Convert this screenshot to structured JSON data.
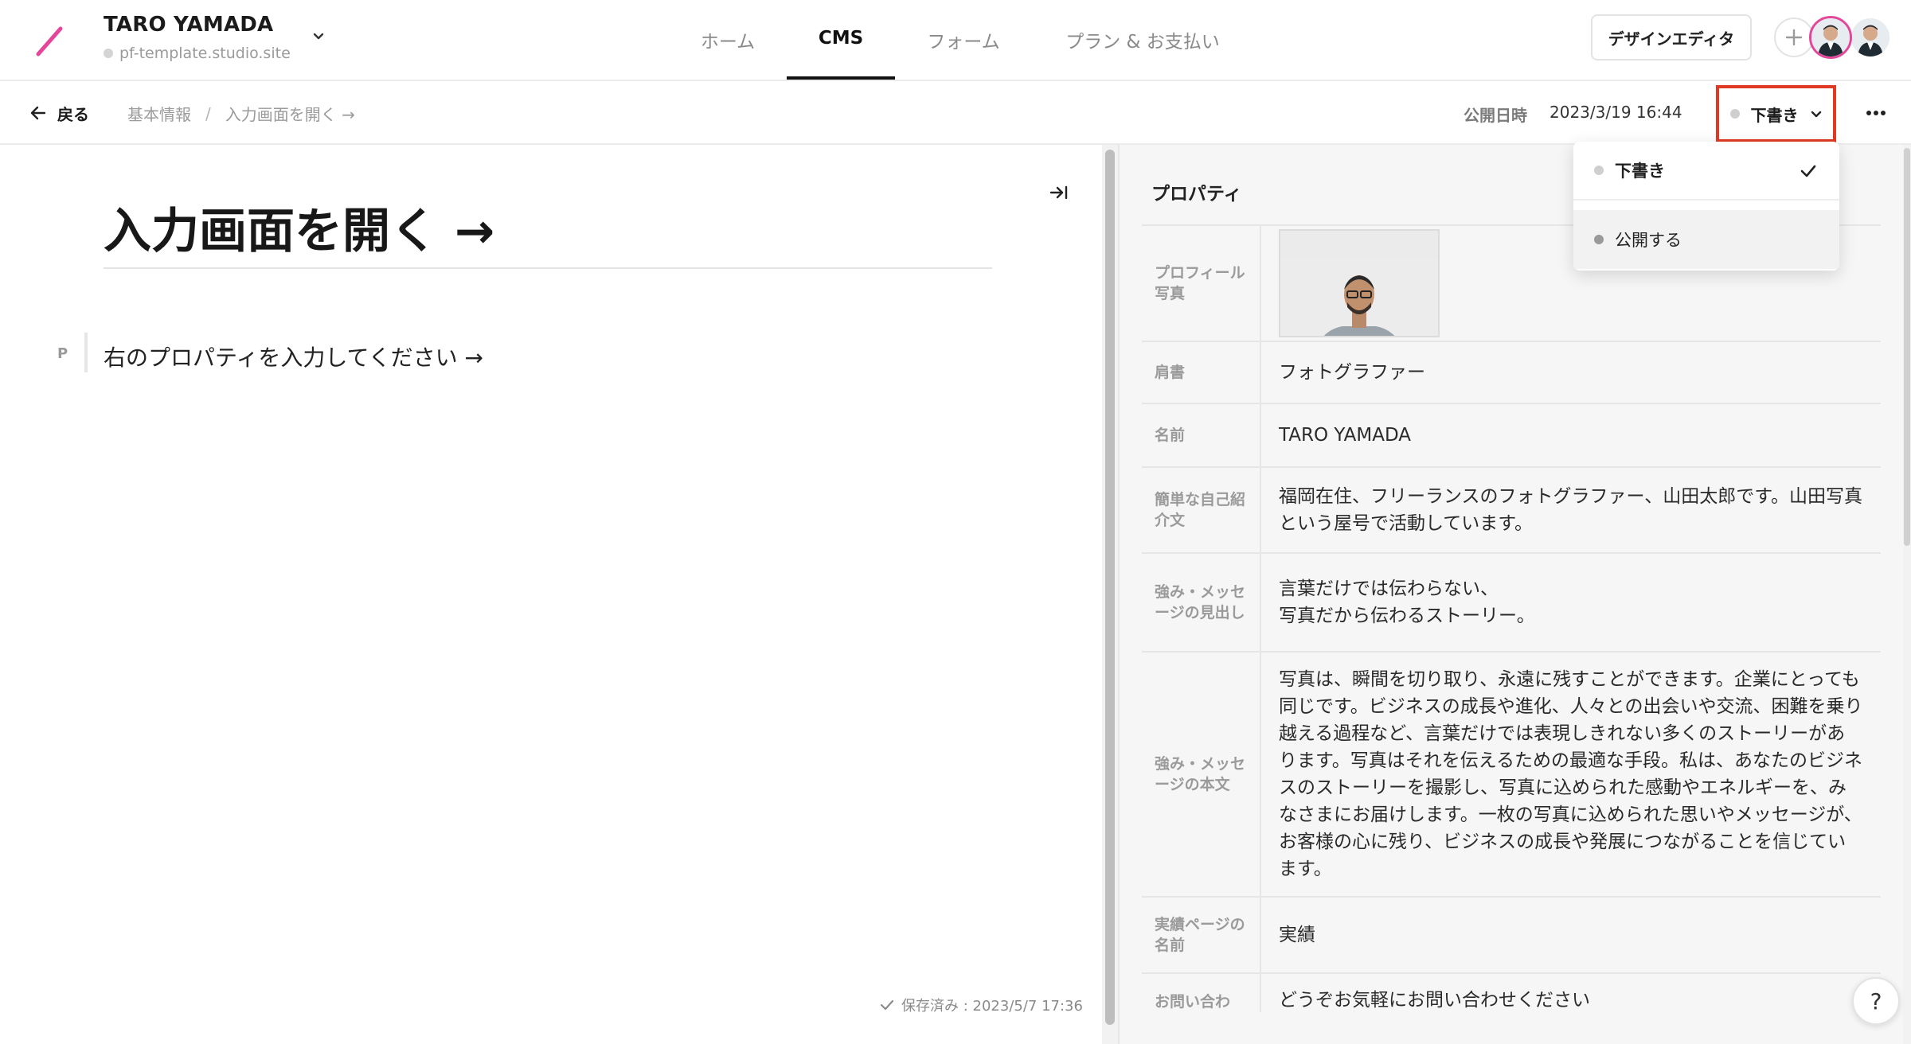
{
  "header": {
    "site_name": "TARO YAMADA",
    "site_url": "pf-template.studio.site",
    "tabs": [
      {
        "label": "ホーム",
        "active": false
      },
      {
        "label": "CMS",
        "active": true
      },
      {
        "label": "フォーム",
        "active": false
      },
      {
        "label": "プラン & お支払い",
        "active": false
      }
    ],
    "design_editor_label": "デザインエディタ",
    "accent_color": "#e4479a"
  },
  "subheader": {
    "back_label": "戻る",
    "breadcrumb": [
      "基本情報",
      "入力画面を開く →"
    ],
    "publish_date_label": "公開日時",
    "publish_date_value": "2023/3/19 16:44",
    "status_label": "下書き",
    "highlight_color": "#e03a24"
  },
  "status_menu": {
    "items": [
      {
        "label": "下書き",
        "selected": true,
        "dot_color": "#cfcfcf"
      },
      {
        "label": "公開する",
        "selected": false,
        "dot_color": "#9a9a9a"
      }
    ]
  },
  "editor": {
    "title": "入力画面を開く →",
    "block_type": "P",
    "paragraph": "右のプロパティを入力してください →",
    "saved_status": "保存済み : 2023/5/7 17:36"
  },
  "properties": {
    "title": "プロパティ",
    "rows": [
      {
        "label": "プロフィール写真",
        "value": ""
      },
      {
        "label": "肩書",
        "value": "フォトグラファー"
      },
      {
        "label": "名前",
        "value": "TARO YAMADA"
      },
      {
        "label": "簡単な自己紹介文",
        "value": "福岡在住、フリーランスのフォトグラファー、山田太郎です。山田写真という屋号で活動しています。"
      },
      {
        "label": "強み・メッセージの見出し",
        "value": "言葉だけでは伝わらない、\n写真だから伝わるストーリー。"
      },
      {
        "label": "強み・メッセージの本文",
        "value": "写真は、瞬間を切り取り、永遠に残すことができます。企業にとっても同じです。ビジネスの成長や進化、人々との出会いや交流、困難を乗り越える過程など、言葉だけでは表現しきれない多くのストーリーがあります。写真はそれを伝えるための最適な手段。私は、あなたのビジネスのストーリーを撮影し、写真に込められた感動やエネルギーを、みなさまにお届けします。一枚の写真に込められた思いやメッセージが、お客様の心に残り、ビジネスの成長や発展につながることを信じています。"
      },
      {
        "label": "実績ページの名前",
        "value": "実績"
      },
      {
        "label": "お問い合わ",
        "value": "どうぞお気軽にお問い合わせください"
      }
    ]
  },
  "help_label": "?"
}
